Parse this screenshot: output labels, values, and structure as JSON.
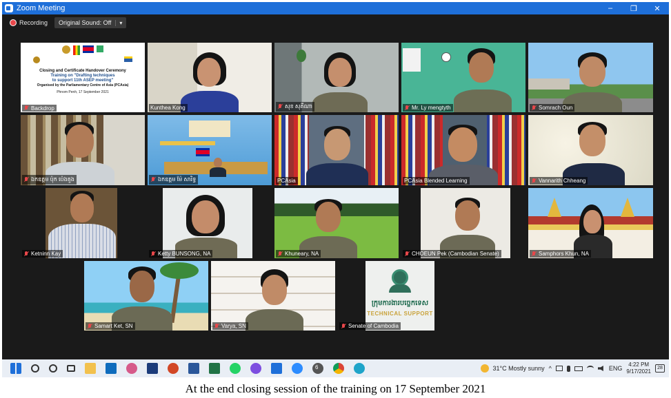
{
  "window": {
    "title": "Zoom Meeting",
    "controls": [
      "–",
      "❐",
      "✕"
    ]
  },
  "toolbar": {
    "recording_label": "Recording",
    "sound_label": "Original Sound: Off",
    "sound_caret": "▾"
  },
  "backdrop_slide": {
    "line1": "Closing and Certificate Handover Ceremony",
    "line2": "Training on \"Drafting techniques",
    "line3": "to support 11th ASEP meeting\"",
    "line4": "Organised by the Parliamentary Centre of Asia (PCAsia)",
    "line5": "Phnom Penh, 17 September 2021"
  },
  "participants": [
    "Backdrop",
    "Kunthea Kong",
    "សុខ សុគីណា",
    "Mr. Ly mengtyth",
    "Somrach Oun",
    "ឯកឧត្តម ប៉ុក ប៉េងគួង",
    "ឯកឧត្តម ម៉ែ សារិទ្ធ",
    "PCAsia",
    "PCAsia Blended Learning",
    "Vannarith Chheang",
    "Ketninn Kay",
    "Ketty BUNSONG, NA",
    "Khuneary, NA",
    "CHOEUN Pek (Cambodian Senate)",
    "Samphors Khun, NA",
    "Samart Ket, SN",
    "Varya, SN",
    "Senate of Cambodia"
  ],
  "tech_support": {
    "khmer": "ក្រុមការងារបច្ចេកទេស",
    "english": "TECHNICAL SUPPORT"
  },
  "taskbar": {
    "weather": "31°C  Mostly sunny",
    "lang": "ENG",
    "time": "4:22 PM",
    "date": "9/17/2021",
    "notifications": "28",
    "zoom_badge": "6"
  },
  "caption": "At the end closing session of the training on 17 September 2021",
  "colors": {
    "titlebar": "#1e6fd9",
    "mic_muted": "#e8474a",
    "active_speaker": "#d8d84a"
  }
}
